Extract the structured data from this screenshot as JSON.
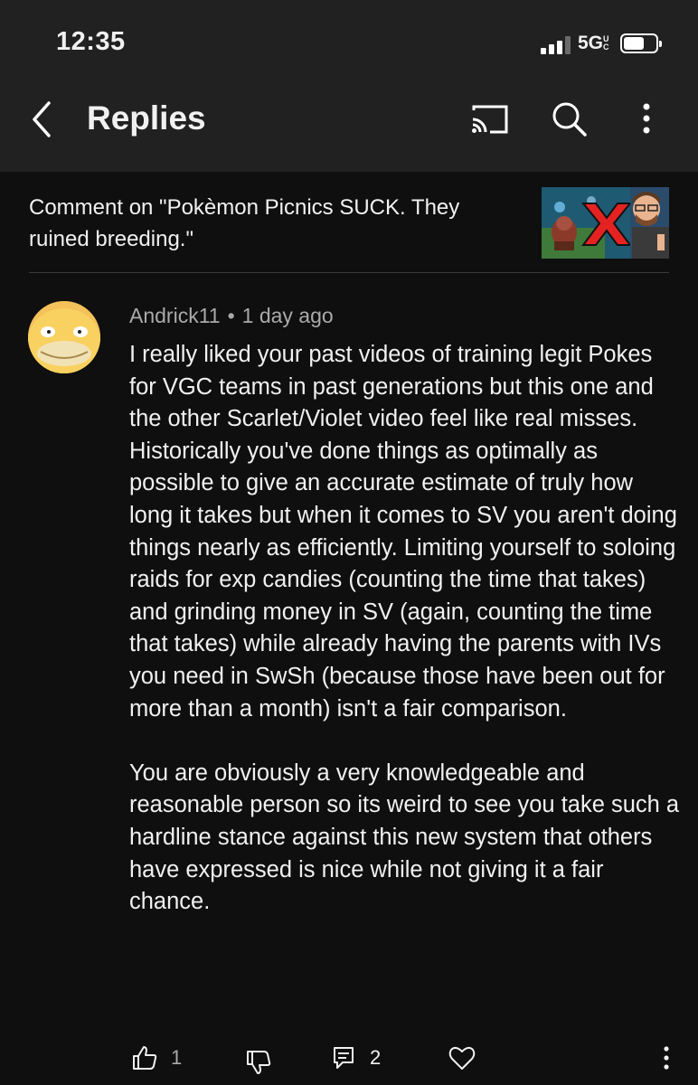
{
  "status_bar": {
    "time": "12:35",
    "network": "5G",
    "network_suffix": "UC"
  },
  "header": {
    "title": "Replies",
    "icons": [
      "back-arrow-icon",
      "cast-icon",
      "search-icon",
      "more-vertical-icon"
    ]
  },
  "context": {
    "text": "Comment on \"Pokèmon Picnics SUCK. They ruined breeding.\""
  },
  "comment": {
    "author": "Andrick11",
    "separator": "•",
    "timestamp": "1 day ago",
    "paragraphs": [
      "I really liked your past videos of training legit Pokes for VGC teams in past generations but this one and the other Scarlet/Violet video feel like real misses.\nHistorically you've done things as optimally as possible to give an accurate estimate of truly how long it takes but when it comes to SV you aren't doing things nearly as efficiently. Limiting yourself to soloing raids for exp candies (counting the time that takes) and grinding money in SV (again, counting the time that takes) while already having the parents with IVs you need in SwSh (because those have been out for more than a month) isn't a fair comparison.",
      "You are obviously a very knowledgeable and reasonable person so its weird to see you take such a hardline stance against this new system that others have expressed is nice while not giving it a fair chance."
    ],
    "like_count": "1",
    "reply_count": "2"
  },
  "colors": {
    "background": "#0f0f0f",
    "header_background": "#212121",
    "text_primary": "#f1f1f1",
    "text_secondary": "#aaaaaa"
  }
}
